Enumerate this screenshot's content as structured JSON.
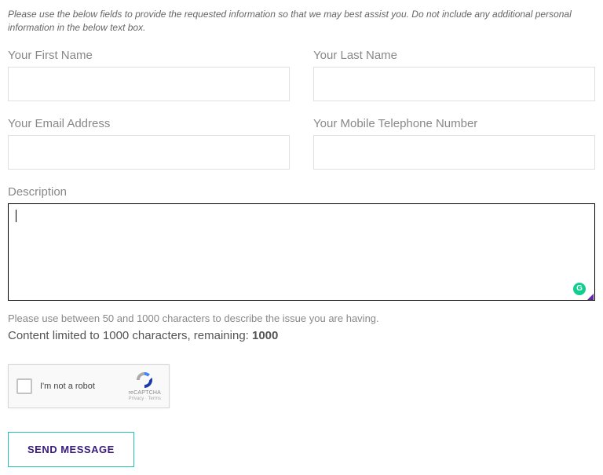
{
  "intro": "Please use the below fields to provide the requested information so that we may best assist you. Do not include any additional personal information in the below text box.",
  "fields": {
    "first_name": {
      "label": "Your First Name",
      "value": ""
    },
    "last_name": {
      "label": "Your Last Name",
      "value": ""
    },
    "email": {
      "label": "Your Email Address",
      "value": ""
    },
    "phone": {
      "label": "Your Mobile Telephone Number",
      "value": ""
    }
  },
  "description": {
    "label": "Description",
    "value": "",
    "hint": "Please use between 50 and 1000 characters to describe the issue you are having.",
    "counter_prefix": "Content limited to 1000 characters, remaining: ",
    "remaining": "1000"
  },
  "grammarly_badge": "G",
  "recaptcha": {
    "label": "I'm not a robot",
    "name": "reCAPTCHA",
    "terms": "Privacy · Terms"
  },
  "send_button": "SEND MESSAGE"
}
